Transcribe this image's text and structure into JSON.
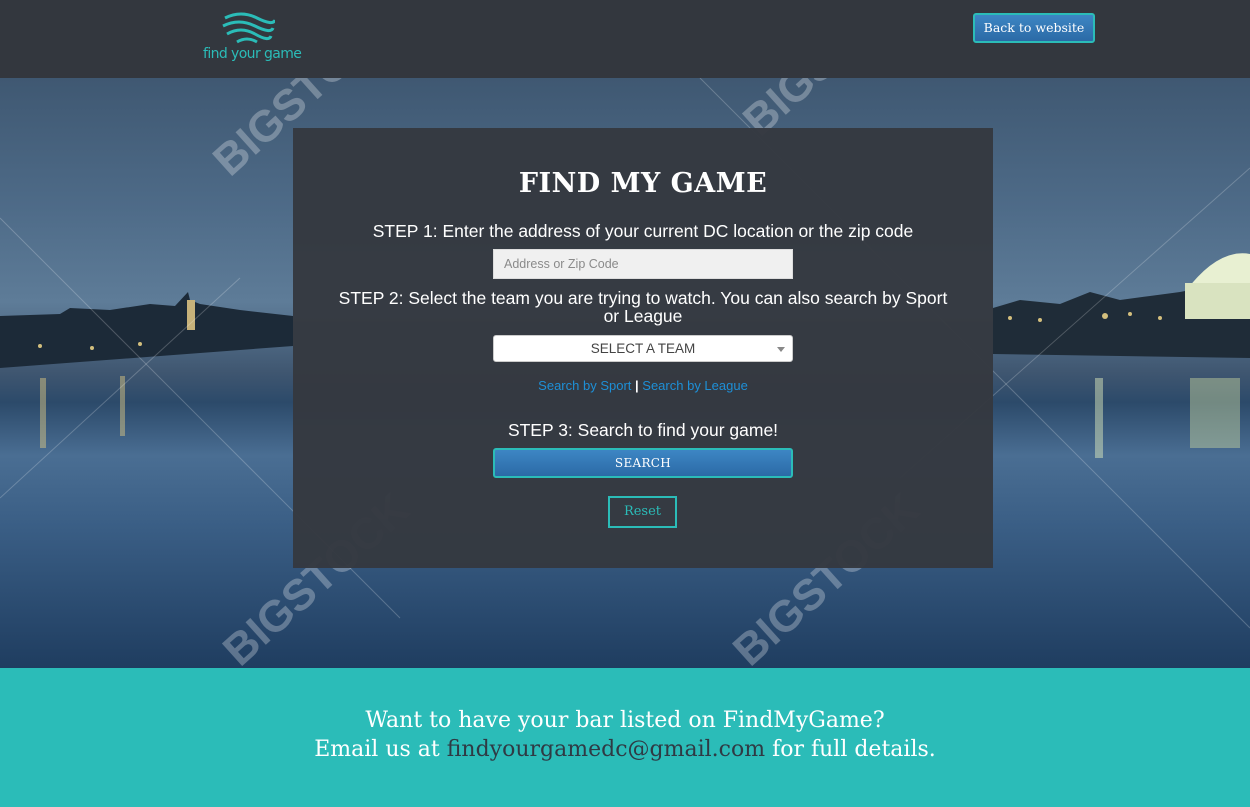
{
  "header": {
    "logo_text": "find your game",
    "back_button": "Back to website"
  },
  "card": {
    "title": "FIND MY GAME",
    "step1": "STEP 1: Enter the address of your current DC location or the zip code",
    "address_placeholder": "Address or Zip Code",
    "step2": "STEP 2: Select the team you are trying to watch. You can also search by Sport or League",
    "team_select": "SELECT A TEAM",
    "link_sport": "Search by Sport",
    "link_separator": "|",
    "link_league": "Search by League",
    "step3": "STEP 3: Search to find your game!",
    "search_button": "SEARCH",
    "reset_button": "Reset"
  },
  "watermark": "BIGSTOCK",
  "footer": {
    "line1": "Want to have your bar listed on FindMyGame?",
    "line2_prefix": "Email us at ",
    "email": "findyourgamedc@gmail.com",
    "line2_suffix": " for full details."
  },
  "colors": {
    "header_bg": "#33373e",
    "accent_teal": "#2bbcb8",
    "button_blue": "#2f73b2",
    "link_blue": "#1e8fd6"
  }
}
